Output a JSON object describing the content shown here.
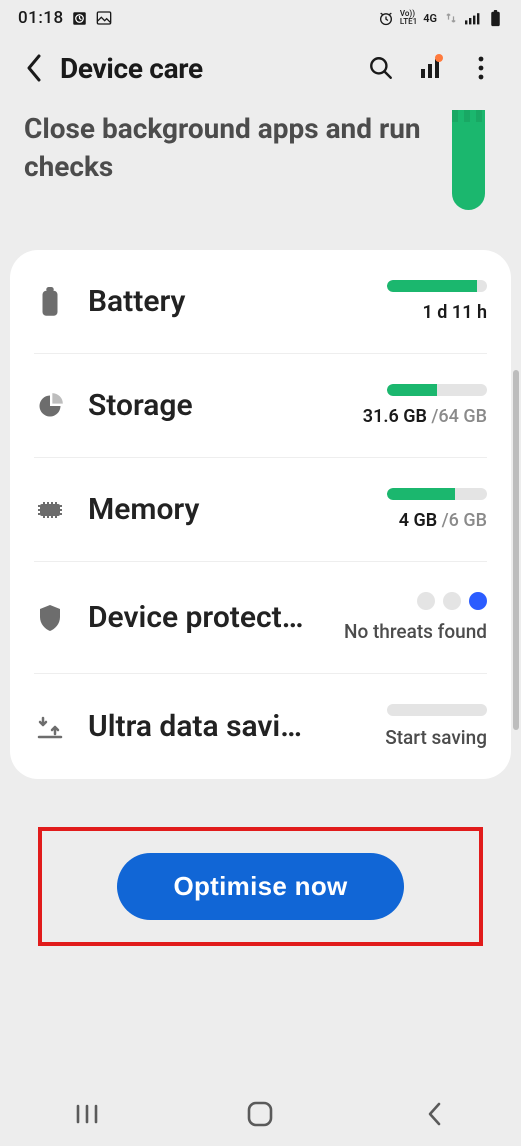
{
  "status": {
    "time": "01:18",
    "lte_top": "Vo))",
    "lte_bottom": "LTE1",
    "net": "4G"
  },
  "appbar": {
    "title": "Device care"
  },
  "tip": {
    "text": "Close background apps and run checks"
  },
  "rows": {
    "battery": {
      "label": "Battery",
      "value": "1 d 11 h",
      "pct": 90
    },
    "storage": {
      "label": "Storage",
      "used": "31.6 GB ",
      "total": "/64 GB",
      "pct": 50
    },
    "memory": {
      "label": "Memory",
      "used": "4 GB ",
      "total": "/6 GB",
      "pct": 68
    },
    "protection": {
      "label": "Device protection",
      "status": "No threats found"
    },
    "ultradata": {
      "label": "Ultra data saving",
      "status": "Start saving",
      "pct": 0
    }
  },
  "cta": {
    "label": "Optimise now"
  },
  "colors": {
    "accent": "#1bb76e",
    "primary": "#1166d6",
    "highlight_box": "#e11b1b"
  }
}
